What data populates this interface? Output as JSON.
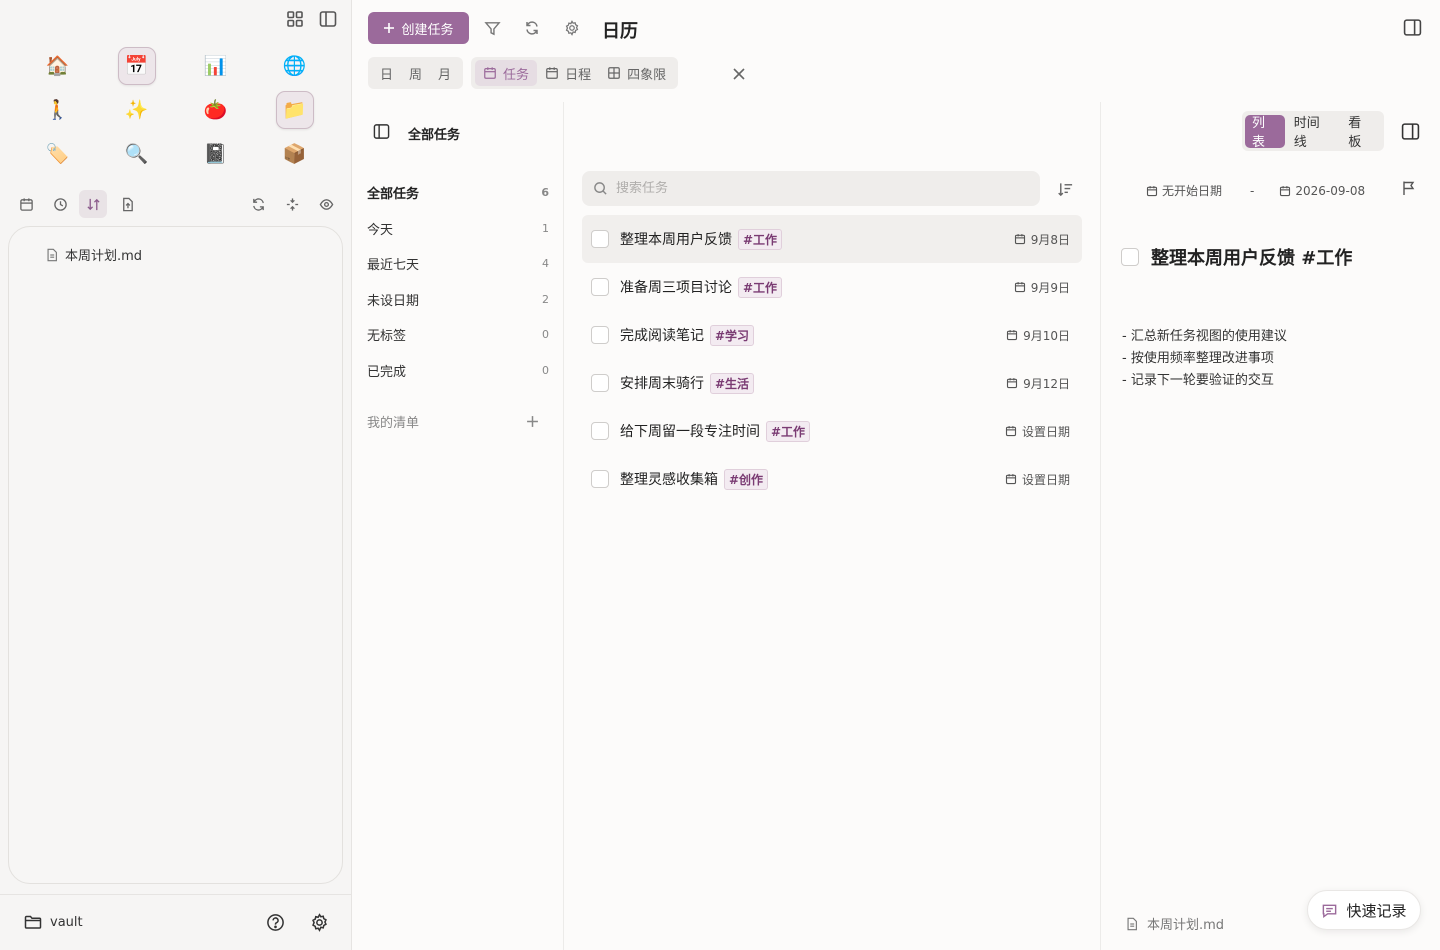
{
  "left": {
    "apps": [
      {
        "name": "home-app",
        "emoji": "🏠",
        "active": false
      },
      {
        "name": "calendar-app",
        "emoji": "📅",
        "active": true
      },
      {
        "name": "chart-app",
        "emoji": "📊",
        "active": false
      },
      {
        "name": "globe-app",
        "emoji": "🌐",
        "active": false
      },
      {
        "name": "walk-app",
        "emoji": "🚶",
        "active": false
      },
      {
        "name": "sparkles-app",
        "emoji": "✨",
        "active": false
      },
      {
        "name": "tomato-app",
        "emoji": "🍅",
        "active": false
      },
      {
        "name": "folder-app",
        "emoji": "📁",
        "active": true
      },
      {
        "name": "tag-app",
        "emoji": "🏷️",
        "active": false
      },
      {
        "name": "search-app",
        "emoji": "🔍",
        "active": false
      },
      {
        "name": "notebook-app",
        "emoji": "📓",
        "active": false
      },
      {
        "name": "box-app",
        "emoji": "📦",
        "active": false
      }
    ],
    "file": "本周计划.md",
    "vault": "vault"
  },
  "header": {
    "create_label": "创建任务",
    "page_title": "日历",
    "tabs_simple": [
      "日",
      "周",
      "月"
    ],
    "tabs_icon": [
      {
        "label": "任务",
        "icon": "calendar-icon",
        "active": true
      },
      {
        "label": "日程",
        "icon": "calendar-icon",
        "active": false
      },
      {
        "label": "四象限",
        "icon": "grid-icon",
        "active": false
      }
    ]
  },
  "nav": {
    "title": "全部任务",
    "items": [
      {
        "label": "全部任务",
        "count": "6",
        "active": true
      },
      {
        "label": "今天",
        "count": "1"
      },
      {
        "label": "最近七天",
        "count": "4"
      },
      {
        "label": "未设日期",
        "count": "2"
      },
      {
        "label": "无标签",
        "count": "0"
      },
      {
        "label": "已完成",
        "count": "0"
      }
    ],
    "my_list": "我的清单"
  },
  "tasks": {
    "search_placeholder": "搜索任务",
    "items": [
      {
        "title": "整理本周用户反馈",
        "tag": "#工作",
        "due": "9月8日",
        "selected": true
      },
      {
        "title": "准备周三项目讨论",
        "tag": "#工作",
        "due": "9月9日"
      },
      {
        "title": "完成阅读笔记",
        "tag": "#学习",
        "due": "9月10日"
      },
      {
        "title": "安排周末骑行",
        "tag": "#生活",
        "due": "9月12日"
      },
      {
        "title": "给下周留一段专注时间",
        "tag": "#工作",
        "due": "设置日期"
      },
      {
        "title": "整理灵感收集箱",
        "tag": "#创作",
        "due": "设置日期"
      }
    ]
  },
  "detail": {
    "modes": [
      {
        "label": "列表",
        "active": true
      },
      {
        "label": "时间线"
      },
      {
        "label": "看板"
      }
    ],
    "start_date": "无开始日期",
    "separator": "-",
    "due_date": "2026-09-08",
    "title": "整理本周用户反馈 #工作",
    "notes": [
      "- 汇总新任务视图的使用建议",
      "- 按使用频率整理改进事项",
      "- 记录下一轮要验证的交互"
    ],
    "file": "本周计划.md",
    "quick_label": "快速记录"
  }
}
